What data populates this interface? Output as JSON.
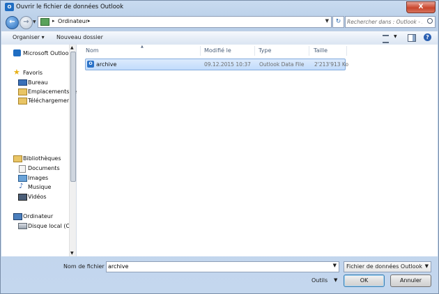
{
  "window": {
    "title": "Ouvrir le fichier de données Outlook",
    "app_icon": "outlook-icon",
    "close_label": "X"
  },
  "navbar": {
    "breadcrumb": "Ordinateur",
    "search_placeholder": "Rechercher dans : Outlook - s..."
  },
  "toolbar": {
    "organize_label": "Organiser ▾",
    "new_folder_label": "Nouveau dossier"
  },
  "nav_pane": {
    "top_item": "Microsoft Outlook",
    "favorites_label": "Favoris",
    "favorites": [
      "Bureau",
      "Emplacements ré",
      "Téléchargements"
    ],
    "libraries_label": "Bibliothèques",
    "libraries": [
      "Documents",
      "Images",
      "Musique",
      "Vidéos"
    ],
    "computer_label": "Ordinateur",
    "drives": [
      "Disque local (C:)"
    ]
  },
  "columns": {
    "name": "Nom",
    "modified": "Modifié le",
    "type": "Type",
    "size": "Taille"
  },
  "files": [
    {
      "name": "archive",
      "modified": "09.12.2015 10:37",
      "type": "Outlook Data File",
      "size": "2'213'913 Ko"
    }
  ],
  "bottom": {
    "file_name_label": "Nom de fichier :",
    "file_name_value": "archive",
    "file_type_filter": "Fichier de données Outlook",
    "tools_label": "Outils",
    "ok_label": "OK",
    "cancel_label": "Annuler"
  }
}
